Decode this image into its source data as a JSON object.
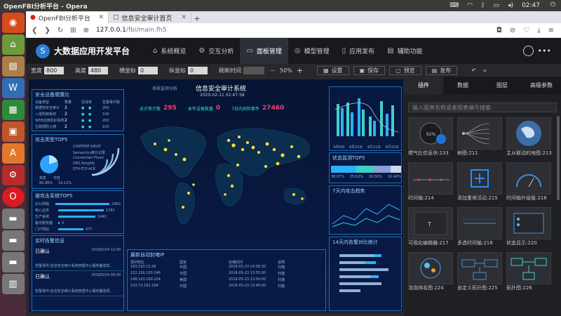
{
  "os": {
    "window_title": "OpenFBI分析平台 - Opera",
    "clock": "02:47"
  },
  "browser": {
    "tabs": [
      {
        "label": "OpenFBI分析平台",
        "active": true
      },
      {
        "label": "信息安全审计首页",
        "active": false
      }
    ],
    "url_host": "127.0.0.1",
    "url_path": "/fbi/main.fh5"
  },
  "app": {
    "name": "大数据应用开发平台",
    "nav": [
      {
        "label": "系统概览",
        "icon": "home-icon"
      },
      {
        "label": "交互分析",
        "icon": "gear-icon"
      },
      {
        "label": "面板管理",
        "icon": "panel-icon",
        "active": true
      },
      {
        "label": "模型管理",
        "icon": "model-icon"
      },
      {
        "label": "应用发布",
        "icon": "publish-icon"
      },
      {
        "label": "辅助功能",
        "icon": "tools-icon"
      }
    ]
  },
  "toolbar": {
    "width_label": "宽度",
    "width_value": "800",
    "height_label": "高度",
    "height_value": "480",
    "x_label": "横坐标",
    "x_value": "0",
    "y_label": "纵坐标",
    "y_value": "0",
    "refresh_label": "刷新时间",
    "zoom": "50%",
    "settings_label": "设置",
    "save_label": "保存",
    "preview_label": "预览",
    "publish_label": "发布"
  },
  "dashboard": {
    "system_link": "系统监测分析",
    "title": "信息安全审计系统",
    "datetime": "2020-02-11 02:47:58",
    "stat1_label": "总计审计数",
    "stat1_value": "295",
    "stat2_label": "本年设备数量",
    "stat2_value": "0",
    "stat3_label": "7日内风险事件",
    "stat3_value": "27460",
    "panel_devices": "安全设备健康比",
    "device_headers": [
      "设备类型",
      "数量",
      "在线率",
      "告警事件数"
    ],
    "devices": [
      {
        "name": "数据库安全审计",
        "count": "2",
        "alarms": "200"
      },
      {
        "name": "入侵防御系统",
        "count": "2",
        "alarms": "100"
      },
      {
        "name": "WEB应用防护系统",
        "count": "2",
        "alarms": "200"
      },
      {
        "name": "互联网防火墙",
        "count": "2",
        "alarms": "100"
      }
    ],
    "panel_attack": "攻击类型TOP5",
    "attack_types": [
      "CONTENT-DROP",
      "Semantics审计记录",
      "Connection-Flood",
      "DNS Amplify",
      "ETH-TCP-ACK"
    ],
    "pie_legend": [
      "高危",
      "中危"
    ],
    "pie_values": [
      "80.88%",
      "19.12%"
    ],
    "panel_targets": "被攻击系统TOP5",
    "target_values": [
      "2463",
      "1781",
      "1442",
      "0",
      "977"
    ],
    "target_names": [
      "办公网络",
      "核心业务",
      "生产系统",
      "备份服务器",
      "门户网站"
    ],
    "panel_alerts": "实时告警信息",
    "alerts": [
      {
        "status": "已确认",
        "time": "2018/5/24 12:00",
        "text": "告警事件:信息安全审计系统管理中心服务器发现..."
      },
      {
        "status": "已确认",
        "time": "2018/5/24 00:00",
        "text": "告警事件:信息安全审计系统管理中心服务器发现..."
      }
    ],
    "panel_recent": "最新自动封堵IP",
    "recent_headers": [
      "源IP地址",
      "国家",
      "封堵时间",
      "说明"
    ],
    "recent_rows": [
      [
        "183.193.15.58",
        "中国",
        "2018-05-23 14:00:30",
        "扫描"
      ],
      [
        "222.226.150.246",
        "中国",
        "2018-05-23 13:55:00",
        "扫描"
      ],
      [
        "148.163.169.224",
        "美国",
        "2018-05-23 13:50:00",
        "扫描"
      ],
      [
        "103.73.161.184",
        "中国",
        "2018-05-23 13:45:00",
        "扫描"
      ]
    ],
    "bar_dates": [
      "4月9日",
      "4月10日",
      "4月11日",
      "4月12日"
    ],
    "panel_status": "状态监测TOP5",
    "status_values": [
      "38.07%",
      "25.62%",
      "26.56%",
      "16.44%"
    ],
    "panel_trend": "7天内攻击趋势",
    "panel_alarm_compare": "14天内告警对比统计"
  },
  "side": {
    "tabs": [
      {
        "label": "插件",
        "active": true
      },
      {
        "label": "数据",
        "active": false
      },
      {
        "label": "图层",
        "active": false
      },
      {
        "label": "高级参数",
        "active": false
      }
    ],
    "search_placeholder": "输入图表名称或者图表编号搜索",
    "gauge_value": "62%",
    "cards": [
      {
        "label": "燃气灶信息块:233",
        "kind": "gauge"
      },
      {
        "label": "树图:211",
        "kind": "tree"
      },
      {
        "label": "主从联动的地图:213",
        "kind": "globe"
      },
      {
        "label": "时间轴:214",
        "kind": "timeline"
      },
      {
        "label": "添加重保活动:215",
        "kind": "plus"
      },
      {
        "label": "时间轴升级版:216",
        "kind": "arc"
      },
      {
        "label": "可视化编辑器:217",
        "kind": "text"
      },
      {
        "label": "多选时间轴:218",
        "kind": "multi"
      },
      {
        "label": "状态显示:220",
        "kind": "status"
      },
      {
        "label": "泡泡排名图:224",
        "kind": "bubble"
      },
      {
        "label": "自定义拓扑图:225",
        "kind": "topo"
      },
      {
        "label": "拓扑图:226",
        "kind": "topo2"
      }
    ]
  }
}
